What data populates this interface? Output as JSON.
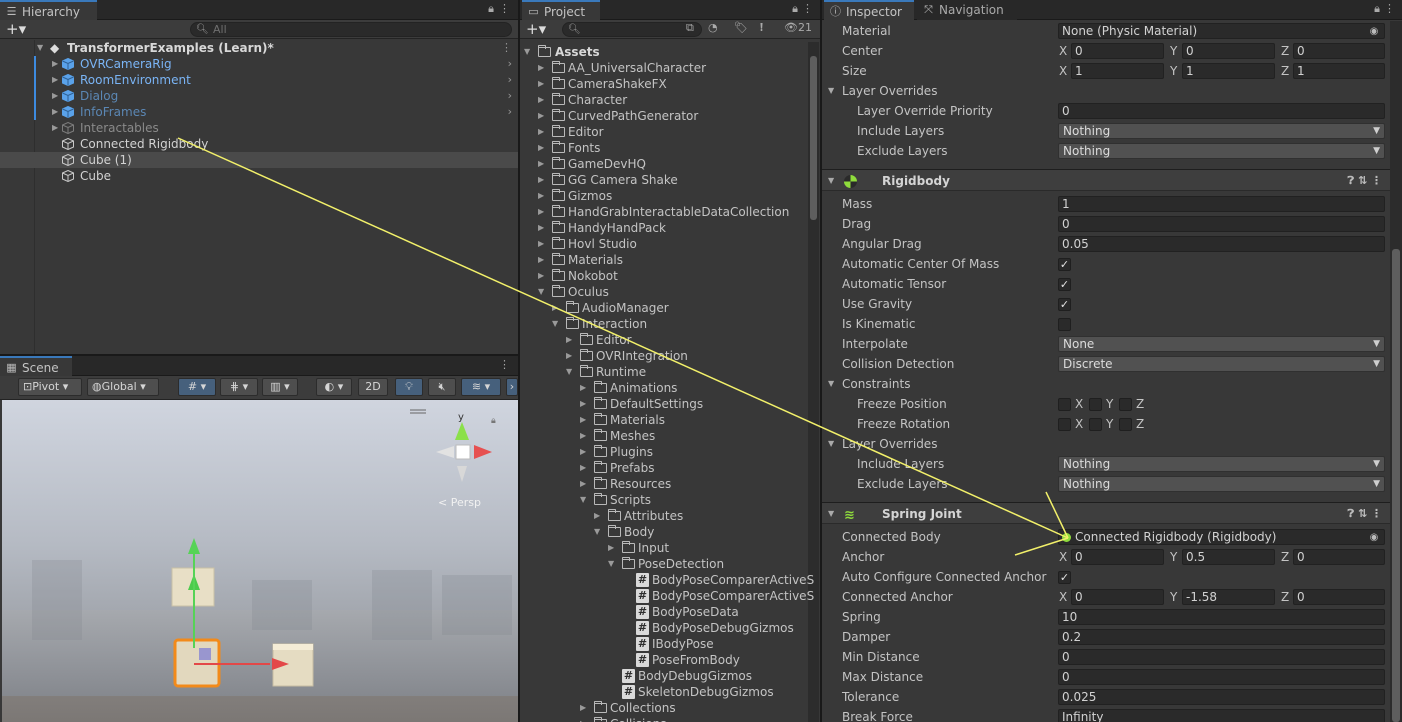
{
  "hierarchy": {
    "tab_label": "Hierarchy",
    "search_placeholder": "All",
    "scene_name": "TransformerExamples (Learn)*",
    "items": [
      {
        "label": "OVRCameraRig",
        "style": "blue"
      },
      {
        "label": "RoomEnvironment",
        "style": "blue"
      },
      {
        "label": "Dialog",
        "style": "dimblue"
      },
      {
        "label": "InfoFrames",
        "style": "dimblue"
      },
      {
        "label": "Interactables",
        "style": "grey"
      },
      {
        "label": "Connected Rigidbody",
        "style": "white"
      },
      {
        "label": "Cube (1)",
        "style": "white"
      },
      {
        "label": "Cube",
        "style": "white"
      }
    ]
  },
  "scene": {
    "tab_label": "Scene",
    "pivot_label": "Pivot",
    "global_label": "Global",
    "mode_2d": "2D",
    "gizmo_label": "Persp",
    "axis_y": "y"
  },
  "project": {
    "tab_label": "Project",
    "hidden_count": "21",
    "root": "Assets",
    "folders": [
      "AA_UniversalCharacter",
      "CameraShakeFX",
      "Character",
      "CurvedPathGenerator",
      "Editor",
      "Fonts",
      "GameDevHQ",
      "GG Camera Shake",
      "Gizmos",
      "HandGrabInteractableDataCollection",
      "HandyHandPack",
      "Hovl Studio",
      "Materials",
      "Nokobot",
      "Oculus"
    ],
    "oculus_children": [
      {
        "label": "AudioManager",
        "kind": "folder",
        "depth": 1,
        "expanded": false
      },
      {
        "label": "Interaction",
        "kind": "folder",
        "depth": 1,
        "expanded": true
      },
      {
        "label": "Editor",
        "kind": "folder",
        "depth": 2,
        "expanded": false
      },
      {
        "label": "OVRIntegration",
        "kind": "folder",
        "depth": 2,
        "expanded": false
      },
      {
        "label": "Runtime",
        "kind": "folder",
        "depth": 2,
        "expanded": true
      },
      {
        "label": "Animations",
        "kind": "folder",
        "depth": 3,
        "expanded": false
      },
      {
        "label": "DefaultSettings",
        "kind": "folder",
        "depth": 3,
        "expanded": false
      },
      {
        "label": "Materials",
        "kind": "folder",
        "depth": 3,
        "expanded": false
      },
      {
        "label": "Meshes",
        "kind": "folder",
        "depth": 3,
        "expanded": false
      },
      {
        "label": "Plugins",
        "kind": "folder",
        "depth": 3,
        "expanded": false
      },
      {
        "label": "Prefabs",
        "kind": "folder",
        "depth": 3,
        "expanded": false
      },
      {
        "label": "Resources",
        "kind": "folder",
        "depth": 3,
        "expanded": false
      },
      {
        "label": "Scripts",
        "kind": "folder",
        "depth": 3,
        "expanded": true
      },
      {
        "label": "Attributes",
        "kind": "folder",
        "depth": 4,
        "expanded": false
      },
      {
        "label": "Body",
        "kind": "folder",
        "depth": 4,
        "expanded": true
      },
      {
        "label": "Input",
        "kind": "folder",
        "depth": 5,
        "expanded": false
      },
      {
        "label": "PoseDetection",
        "kind": "folder",
        "depth": 5,
        "expanded": true
      },
      {
        "label": "BodyPoseComparerActiveS",
        "kind": "script",
        "depth": 6
      },
      {
        "label": "BodyPoseComparerActiveS",
        "kind": "script",
        "depth": 6
      },
      {
        "label": "BodyPoseData",
        "kind": "script",
        "depth": 6
      },
      {
        "label": "BodyPoseDebugGizmos",
        "kind": "script",
        "depth": 6
      },
      {
        "label": "IBodyPose",
        "kind": "script",
        "depth": 6
      },
      {
        "label": "PoseFromBody",
        "kind": "script",
        "depth": 6
      },
      {
        "label": "BodyDebugGizmos",
        "kind": "script",
        "depth": 5
      },
      {
        "label": "SkeletonDebugGizmos",
        "kind": "script",
        "depth": 5
      },
      {
        "label": "Collections",
        "kind": "folder",
        "depth": 3,
        "expanded": false
      },
      {
        "label": "Collisions",
        "kind": "folder",
        "depth": 3,
        "expanded": false
      }
    ]
  },
  "inspector": {
    "tab_label": "Inspector",
    "nav_tab_label": "Navigation",
    "collider": {
      "material_label": "Material",
      "material_value": "None (Physic Material)",
      "center_label": "Center",
      "center": {
        "x": "0",
        "y": "0",
        "z": "0"
      },
      "size_label": "Size",
      "size": {
        "x": "1",
        "y": "1",
        "z": "1"
      },
      "layer_overrides_label": "Layer Overrides",
      "priority_label": "Layer Override Priority",
      "priority_value": "0",
      "include_label": "Include Layers",
      "include_value": "Nothing",
      "exclude_label": "Exclude Layers",
      "exclude_value": "Nothing"
    },
    "rigidbody": {
      "title": "Rigidbody",
      "mass_label": "Mass",
      "mass": "1",
      "drag_label": "Drag",
      "drag": "0",
      "angular_drag_label": "Angular Drag",
      "angular_drag": "0.05",
      "auto_com_label": "Automatic Center Of Mass",
      "auto_tensor_label": "Automatic Tensor",
      "use_gravity_label": "Use Gravity",
      "is_kinematic_label": "Is Kinematic",
      "interpolate_label": "Interpolate",
      "interpolate": "None",
      "collision_label": "Collision Detection",
      "collision": "Discrete",
      "constraints_label": "Constraints",
      "freeze_pos_label": "Freeze Position",
      "freeze_rot_label": "Freeze Rotation",
      "layer_overrides_label": "Layer Overrides",
      "include_label": "Include Layers",
      "include_value": "Nothing",
      "exclude_label": "Exclude Layers",
      "exclude_value": "Nothing"
    },
    "spring": {
      "title": "Spring Joint",
      "connected_body_label": "Connected Body",
      "connected_body": "Connected Rigidbody (Rigidbody)",
      "anchor_label": "Anchor",
      "anchor": {
        "x": "0",
        "y": "0.5",
        "z": "0"
      },
      "auto_config_label": "Auto Configure Connected Anchor",
      "connected_anchor_label": "Connected Anchor",
      "connected_anchor": {
        "x": "0",
        "y": "-1.58",
        "z": "0"
      },
      "spring_label": "Spring",
      "spring": "10",
      "damper_label": "Damper",
      "damper": "0.2",
      "min_label": "Min Distance",
      "min": "0",
      "max_label": "Max Distance",
      "max": "0",
      "tol_label": "Tolerance",
      "tol": "0.025",
      "break_label": "Break Force",
      "break": "Infinity"
    },
    "axes": {
      "x": "X",
      "y": "Y",
      "z": "Z"
    }
  },
  "colors": {
    "accent": "#3a79bb",
    "annotation": "#f2f06a",
    "panel": "#383838"
  }
}
